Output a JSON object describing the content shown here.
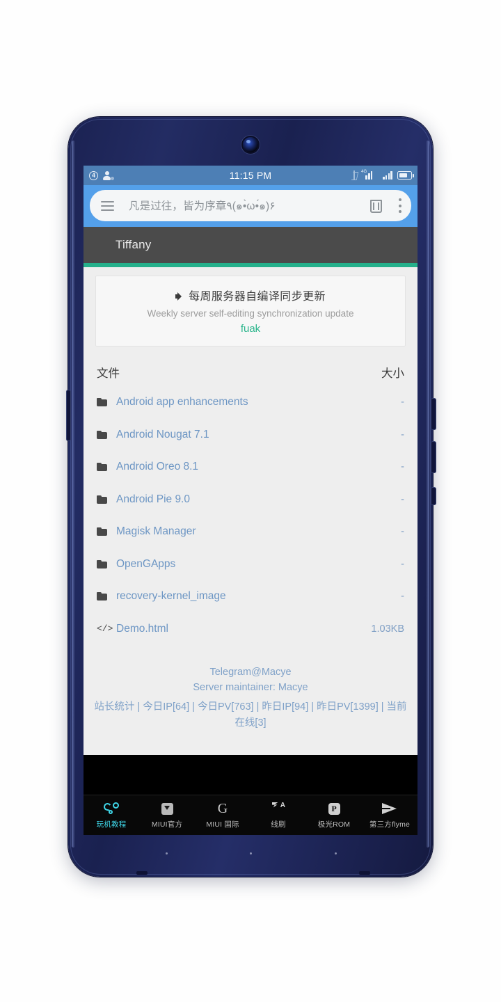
{
  "statusbar": {
    "notification_count": "4",
    "clock": "11:15 PM",
    "network_label": "4G"
  },
  "browser": {
    "url_text": "凡是过往，皆为序章٩(๑•̀ω•́๑)۶",
    "menu_icon": "hamburger-menu-icon",
    "trash_icon": "trash-icon",
    "overflow_icon": "more-vertical-icon"
  },
  "site": {
    "title": "Tiffany",
    "accent_color": "#25b08b"
  },
  "notice": {
    "headline_cn": "每周服务器自编译同步更新",
    "headline_en": "Weekly server self-editing synchronization update",
    "link": "fuak",
    "speaker_icon": "speaker-icon"
  },
  "files": {
    "header": {
      "name": "文件",
      "size": "大小"
    },
    "rows": [
      {
        "icon": "folder",
        "name": "Android app enhancements",
        "size": "-"
      },
      {
        "icon": "folder",
        "name": "Android Nougat 7.1",
        "size": "-"
      },
      {
        "icon": "folder",
        "name": "Android Oreo 8.1",
        "size": "-"
      },
      {
        "icon": "folder",
        "name": "Android Pie 9.0",
        "size": "-"
      },
      {
        "icon": "folder",
        "name": "Magisk Manager",
        "size": "-"
      },
      {
        "icon": "folder",
        "name": "OpenGApps",
        "size": "-"
      },
      {
        "icon": "folder",
        "name": "recovery-kernel_image",
        "size": "-"
      },
      {
        "icon": "code",
        "name": "Demo.html",
        "size": "1.03KB"
      }
    ]
  },
  "footer": {
    "line1": "Telegram@Macye",
    "line2": "Server maintainer: Macye",
    "stats": "站长统计 | 今日IP[64] | 今日PV[763] | 昨日IP[94] | 昨日PV[1399] | 当前在线[3]"
  },
  "appnav": {
    "items": [
      {
        "label": "玩机教程",
        "icon": "steam-logo-icon",
        "active": true
      },
      {
        "label": "MIUI官方",
        "icon": "download-box-icon",
        "active": false
      },
      {
        "label": "MIUI 国际",
        "icon": "google-g-icon",
        "active": false
      },
      {
        "label": "线刷",
        "icon": "flash-bolt-a-icon",
        "active": false
      },
      {
        "label": "极光ROM",
        "icon": "pinterest-p-icon",
        "active": false
      },
      {
        "label": "第三方flyme",
        "icon": "send-arrow-icon",
        "active": false
      }
    ]
  }
}
